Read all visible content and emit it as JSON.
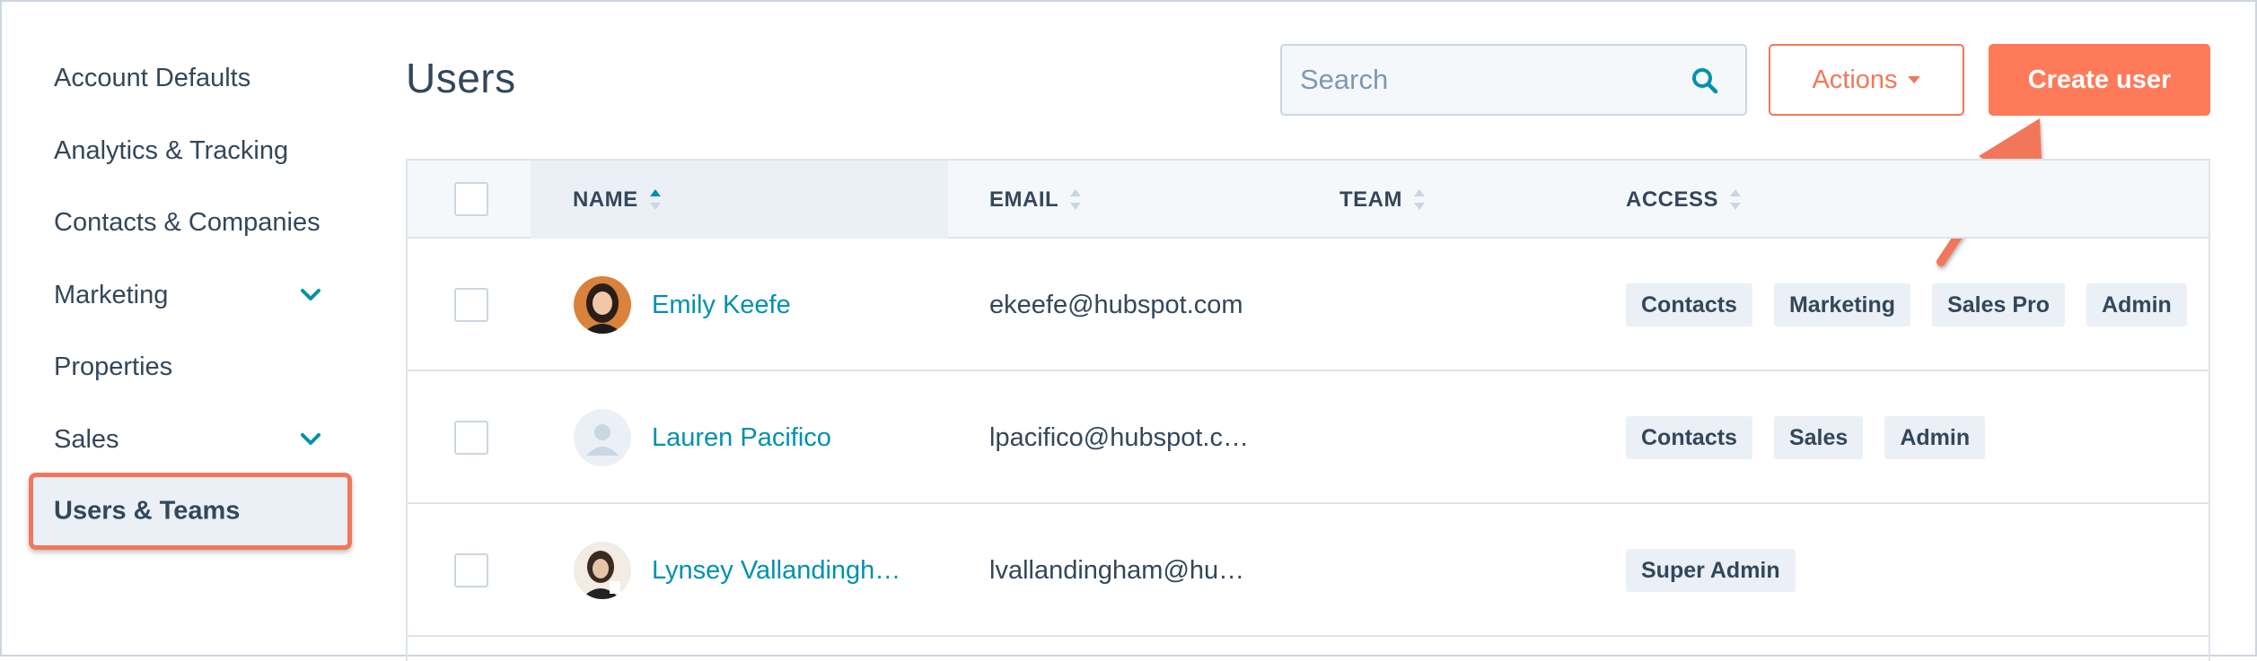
{
  "sidebar": {
    "items": [
      {
        "label": "Account Defaults"
      },
      {
        "label": "Analytics & Tracking"
      },
      {
        "label": "Contacts & Companies"
      },
      {
        "label": "Marketing"
      },
      {
        "label": "Properties"
      },
      {
        "label": "Sales"
      },
      {
        "label": "Users & Teams"
      }
    ]
  },
  "header": {
    "title": "Users",
    "search_placeholder": "Search",
    "actions_label": "Actions",
    "create_label": "Create user"
  },
  "table": {
    "columns": [
      "NAME",
      "EMAIL",
      "TEAM",
      "ACCESS"
    ],
    "rows": [
      {
        "name": "Emily Keefe",
        "email": "ekeefe@hubspot.com",
        "team": "",
        "access": [
          "Contacts",
          "Marketing",
          "Sales Pro",
          "Admin"
        ]
      },
      {
        "name": "Lauren Pacifico",
        "email": "lpacifico@hubspot.c…",
        "team": "",
        "access": [
          "Contacts",
          "Sales",
          "Admin"
        ]
      },
      {
        "name": "Lynsey Vallandingh…",
        "email": "lvallandingham@hu…",
        "team": "",
        "access": [
          "Super Admin"
        ]
      }
    ]
  },
  "colors": {
    "accent": "#ff7a59",
    "link": "#0091ae",
    "text": "#33475b",
    "highlight_border": "#f2775a"
  },
  "icons": [
    "search-icon",
    "chevron-down-icon",
    "caret-down-icon",
    "sort-icon",
    "arrow-annotation"
  ]
}
